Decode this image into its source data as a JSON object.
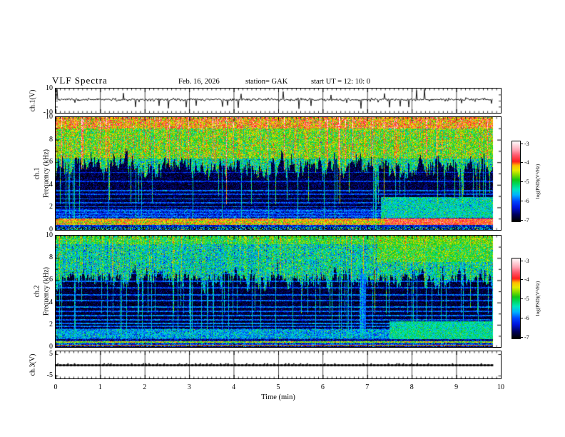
{
  "header": {
    "title": "VLF Spectra",
    "date": "Feb. 16, 2026",
    "station": "station= GAK",
    "start_ut": "start UT =  12: 10: 0"
  },
  "xaxis": {
    "label": "Time (min)",
    "ticks": [
      "0",
      "1",
      "2",
      "3",
      "4",
      "5",
      "6",
      "7",
      "8",
      "9",
      "10"
    ]
  },
  "panels": {
    "wave1": {
      "axis_label": "ch.1(V)",
      "yticks": [
        "10",
        "-10"
      ]
    },
    "spec1": {
      "channel_label": "ch.1",
      "axis_label": "Frequency (kHz)",
      "yticks": [
        "10",
        "8",
        "6",
        "4",
        "2",
        "0"
      ]
    },
    "spec2": {
      "channel_label": "ch.2",
      "axis_label": "Frequency (kHz)",
      "yticks": [
        "10",
        "8",
        "6",
        "4",
        "2",
        "0"
      ]
    },
    "wave3": {
      "axis_label": "ch.3(V)",
      "yticks": [
        "5",
        "-5"
      ]
    }
  },
  "colorbar": {
    "label": "log(PSD)(V²/Hz)",
    "ticks": [
      "-3",
      "-4",
      "-5",
      "-6",
      "-7"
    ]
  },
  "colors": {
    "background": "#ffffff",
    "axis": "#000000",
    "trace": "#000000",
    "colormap": [
      [
        0.0,
        "#000000"
      ],
      [
        0.08,
        "#00005a"
      ],
      [
        0.17,
        "#0014dc"
      ],
      [
        0.25,
        "#0046ff"
      ],
      [
        0.33,
        "#00b4ff"
      ],
      [
        0.4,
        "#00e6be"
      ],
      [
        0.47,
        "#00d75a"
      ],
      [
        0.52,
        "#14c814"
      ],
      [
        0.58,
        "#82dc00"
      ],
      [
        0.64,
        "#e6eb00"
      ],
      [
        0.7,
        "#ffbe00"
      ],
      [
        0.75,
        "#ff1e1e"
      ],
      [
        0.83,
        "#ff5a6e"
      ],
      [
        0.9,
        "#ffaab9"
      ],
      [
        1.0,
        "#fffafa"
      ]
    ]
  },
  "chart_data": [
    {
      "type": "line",
      "panel": "ch.1(V)",
      "xlabel": "Time (min)",
      "xlim": [
        0,
        10
      ],
      "ylim": [
        -10,
        10
      ],
      "yticks": [
        10,
        -10
      ],
      "record_length_min": 9.8,
      "summary": "Noisy broadband VLF voltage trace centered near +1 V with impulsive sferic spikes reaching about +9.5 V and -6.5 V; data ends at ~9.8 min of the 10 min axis."
    },
    {
      "type": "heatmap",
      "panel": "ch.1 spectrogram",
      "xlabel": "Time (min)",
      "xlim": [
        0,
        10
      ],
      "ylabel": "Frequency (kHz)",
      "ylim": [
        0,
        10
      ],
      "yticks": [
        0,
        2,
        4,
        6,
        8,
        10
      ],
      "zlabel": "log(PSD)(V²/Hz)",
      "zlim": [
        -7,
        -3
      ],
      "zticks": [
        -3,
        -4,
        -5,
        -6,
        -7
      ],
      "legend_position": "right colorbar",
      "features": [
        "intense sferic activity above ~5-8 kHz (log PSD ≈ -5 to -4, green/yellow) with scattered red columns and red speckle near 9-10 kHz",
        "dark quiet background ≈ -6.8 below the per-column sferic cutoff (icicle pattern)",
        "thin vertical broadband impulse streaks extending to 0 kHz",
        "narrowband horizontal lines between ~1.2 and 5 kHz",
        "strong orange/red band at 0.4-1.0 kHz (≈ -4.4) running full width, intensifying to ≈ -4 after 7.4 min",
        "diffuse green emission patch 1-3 kHz from ~7.3 to 9.8 min",
        "dark speckled strip below 0.25 kHz"
      ]
    },
    {
      "type": "heatmap",
      "panel": "ch.2 spectrogram",
      "xlabel": "Time (min)",
      "xlim": [
        0,
        10
      ],
      "ylabel": "Frequency (kHz)",
      "ylim": [
        0,
        10
      ],
      "yticks": [
        0,
        2,
        4,
        6,
        8,
        10
      ],
      "zlabel": "log(PSD)(V²/Hz)",
      "zlim": [
        -7,
        -3
      ],
      "zticks": [
        -3,
        -4,
        -5,
        -6,
        -7
      ],
      "legend_position": "right colorbar",
      "features": [
        "bright green band 9.3-10 kHz; cyan-green sferic icicles descending to ~5-7 kHz",
        "dark background ≈ -6.8 with many thin horizontal cyan power-line harmonic lines from ~1.8 to 8 kHz",
        "cyan band 0.75-1.6 kHz; yellow-green narrow line near 0.45 kHz; thin red line near 0.18 kHz",
        "green emission patch 0.7-2.3 kHz from ~7.5 to 9.8 min",
        "brighter yellow-green upper region above 7.6 kHz after ~7.2 min",
        "faint brighter vertical column near 6.9 min"
      ]
    },
    {
      "type": "line",
      "panel": "ch.3(V)",
      "xlabel": "Time (min)",
      "xlim": [
        0,
        10
      ],
      "ylim": [
        -6.3,
        6.3
      ],
      "yticks": [
        5,
        -5
      ],
      "record_length_min": 9.8,
      "summary": "Quiet channel: flat thick dashed-looking trace at 0 V for the full ~9.8 min record."
    }
  ],
  "render_model": {
    "seed": 1234,
    "ch1_wave": {
      "mean": 0.9,
      "noise": 0.55,
      "spike_prob": 0.03,
      "down_frac": 0.6,
      "spike_min": 2,
      "spike_span": 5,
      "spikes": [
        [
          2,
          9.5
        ],
        [
          95,
          6.2
        ],
        [
          158,
          -6.2
        ],
        [
          260,
          5.6
        ],
        [
          341,
          -6.6
        ],
        [
          468,
          -5.4
        ],
        [
          506,
          8.6
        ],
        [
          517,
          9.4
        ]
      ]
    },
    "ch1_spec": {
      "cut": {
        "mean": 5.6,
        "sd": 1.15,
        "min": 2.3,
        "max": 7.8,
        "deep_prob": 0.06,
        "deep_mean": 2.6
      },
      "zones": [
        {
          "f0": 9.0,
          "v": -4.2,
          "n": 0.42,
          "red": 0.1
        },
        {
          "f0": 6.3,
          "v": -4.75,
          "n": 0.4,
          "red": 0.02
        },
        {
          "f0": 0,
          "v": -5.25,
          "n": 0.45
        }
      ],
      "bg": {
        "v": -6.78,
        "n": 0.22
      },
      "streak_prob": 0.05,
      "streak_v": -5.55,
      "hot_prob": 0.07,
      "hot_boost": 0.85,
      "low": {
        "fmax": 1.9,
        "v": -6.3,
        "n": 0.35
      },
      "hlines": [
        {
          "f": 5.1,
          "v": -6.2
        },
        {
          "f": 4.3,
          "v": -6.15
        },
        {
          "f": 3.5,
          "v": -5.95
        },
        {
          "f": 3.15,
          "v": -6.1
        },
        {
          "f": 2.75,
          "v": -5.9
        },
        {
          "f": 2.4,
          "v": -6.0
        },
        {
          "f": 2.05,
          "v": -6.0
        },
        {
          "f": 1.7,
          "v": -5.9
        },
        {
          "f": 1.45,
          "v": -6.05
        },
        {
          "f": 1.2,
          "v": -6.0
        }
      ],
      "bands": [
        {
          "f0": 0.42,
          "f1": 1.0,
          "v": -4.45,
          "n": 0.4
        },
        {
          "f0": 0.5,
          "f1": 0.6,
          "v": -4.05,
          "n": 0.3
        },
        {
          "f0": 0.84,
          "f1": 0.94,
          "v": -4.2,
          "n": 0.3
        },
        {
          "f0": 0.42,
          "f1": 1.02,
          "t0": 7.4,
          "v": -3.95,
          "n": 0.3
        },
        {
          "f0": 1.05,
          "f1": 2.9,
          "t0": 7.3,
          "v": -5.4,
          "n": 0.35
        },
        {
          "f0": 0.0,
          "f1": 0.25,
          "set": true,
          "v": -6.1,
          "n": 0.9
        }
      ]
    },
    "ch2_spec": {
      "cut": {
        "mean": 6.1,
        "sd": 1.1,
        "min": 3.0,
        "max": 8.8,
        "deep_prob": 0.05,
        "deep_mean": 2.3
      },
      "zones": [
        {
          "f0": 9.25,
          "v": -4.95,
          "n": 0.35,
          "red": 0.015
        },
        {
          "f0": 6.0,
          "v": -5.35,
          "n": 0.45
        },
        {
          "f0": 0,
          "v": -5.6,
          "n": 0.45
        }
      ],
      "bg": {
        "v": -6.82,
        "n": 0.2
      },
      "streak_prob": 0.06,
      "streak_v": -5.6,
      "hot_prob": 0.05,
      "hot_boost": 0.6,
      "low": {
        "fmax": 1.65,
        "v": -6.15,
        "n": 0.4
      },
      "hlines": [
        {
          "f": 8.2,
          "v": -6.15
        },
        {
          "f": 7.4,
          "v": -6.1
        },
        {
          "f": 6.6,
          "v": -6.05
        },
        {
          "f": 5.9,
          "v": -6.0
        },
        {
          "f": 5.3,
          "v": -6.05
        },
        {
          "f": 4.7,
          "v": -5.95
        },
        {
          "f": 4.15,
          "v": -6.0
        },
        {
          "f": 3.6,
          "v": -5.9
        },
        {
          "f": 3.2,
          "v": -6.0
        },
        {
          "f": 2.8,
          "v": -5.9
        },
        {
          "f": 2.45,
          "v": -5.95
        },
        {
          "f": 2.1,
          "v": -5.85
        },
        {
          "f": 1.85,
          "v": -5.95
        }
      ],
      "bands": [
        {
          "f0": 0.75,
          "f1": 1.6,
          "v": -5.75,
          "n": 0.45
        },
        {
          "f0": 0.38,
          "f1": 0.5,
          "v": -4.6,
          "n": 0.3
        },
        {
          "f0": 0.14,
          "f1": 0.22,
          "v": -4.2,
          "n": 0.2
        },
        {
          "f0": 0.55,
          "f1": 0.72,
          "set": true,
          "v": -6.6,
          "n": 0.3
        },
        {
          "f0": 0.0,
          "f1": 0.12,
          "set": true,
          "v": -6.5,
          "n": 0.4
        },
        {
          "f0": 0.7,
          "f1": 2.3,
          "t0": 7.5,
          "v": -5.35,
          "n": 0.3
        },
        {
          "f0": 7.6,
          "f1": 10.0,
          "t0": 7.2,
          "v": -5.05,
          "n": 0.4
        },
        {
          "f0": 1.2,
          "f1": 8.0,
          "t0": 6.82,
          "t1": 6.97,
          "v": -5.95,
          "n": 0.25
        }
      ]
    },
    "ch3_wave": {
      "level": 0,
      "dash_step": 5,
      "bump_prob": 0.45
    }
  }
}
